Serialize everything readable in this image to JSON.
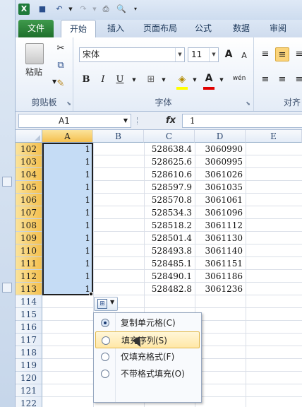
{
  "qat": {
    "undo_label": "↶",
    "redo_label": "↷"
  },
  "tabs": [
    "文件",
    "开始",
    "插入",
    "页面布局",
    "公式",
    "数据",
    "审阅"
  ],
  "ribbon": {
    "clipboard": {
      "paste_label": "粘贴",
      "group_label": "剪贴板"
    },
    "font": {
      "family": "宋体",
      "size": "11",
      "grow": "A",
      "shrink": "A",
      "bold": "B",
      "italic": "I",
      "underline": "U",
      "group_label": "字体",
      "color_label": "A",
      "phonetic": "wén"
    },
    "align": {
      "group_label": "对齐"
    }
  },
  "formula_bar": {
    "name_box": "A1",
    "fx": "fx",
    "value": "1"
  },
  "columns": [
    "A",
    "B",
    "C",
    "D",
    "E"
  ],
  "rows": [
    {
      "num": "102",
      "a": "1",
      "c": "528638.4",
      "d": "3060990"
    },
    {
      "num": "103",
      "a": "1",
      "c": "528625.6",
      "d": "3060995"
    },
    {
      "num": "104",
      "a": "1",
      "c": "528610.6",
      "d": "3061026"
    },
    {
      "num": "105",
      "a": "1",
      "c": "528597.9",
      "d": "3061035"
    },
    {
      "num": "106",
      "a": "1",
      "c": "528570.8",
      "d": "3061061"
    },
    {
      "num": "107",
      "a": "1",
      "c": "528534.3",
      "d": "3061096"
    },
    {
      "num": "108",
      "a": "1",
      "c": "528518.2",
      "d": "3061112"
    },
    {
      "num": "109",
      "a": "1",
      "c": "528501.4",
      "d": "3061130"
    },
    {
      "num": "110",
      "a": "1",
      "c": "528493.8",
      "d": "3061140"
    },
    {
      "num": "111",
      "a": "1",
      "c": "528485.1",
      "d": "3061151"
    },
    {
      "num": "112",
      "a": "1",
      "c": "528490.1",
      "d": "3061186"
    },
    {
      "num": "113",
      "a": "1",
      "c": "528482.8",
      "d": "3061236"
    },
    {
      "num": "114",
      "a": "",
      "c": "",
      "d": ""
    },
    {
      "num": "115",
      "a": "",
      "c": "",
      "d": ""
    },
    {
      "num": "116",
      "a": "",
      "c": "",
      "d": ""
    },
    {
      "num": "117",
      "a": "",
      "c": "",
      "d": ""
    },
    {
      "num": "118",
      "a": "",
      "c": "",
      "d": ""
    },
    {
      "num": "119",
      "a": "",
      "c": "",
      "d": ""
    },
    {
      "num": "120",
      "a": "",
      "c": "",
      "d": ""
    },
    {
      "num": "121",
      "a": "",
      "c": "",
      "d": ""
    },
    {
      "num": "122",
      "a": "",
      "c": "",
      "d": ""
    }
  ],
  "autofill_menu": {
    "items": [
      "复制单元格(C)",
      "填充序列(S)",
      "仅填充格式(F)",
      "不带格式填充(O)"
    ],
    "selected": 0,
    "hovered": 1
  },
  "colors": {
    "selection": "#c5dcf5",
    "header_selected": "#f5c04f",
    "file_tab": "#1e6f2b"
  }
}
